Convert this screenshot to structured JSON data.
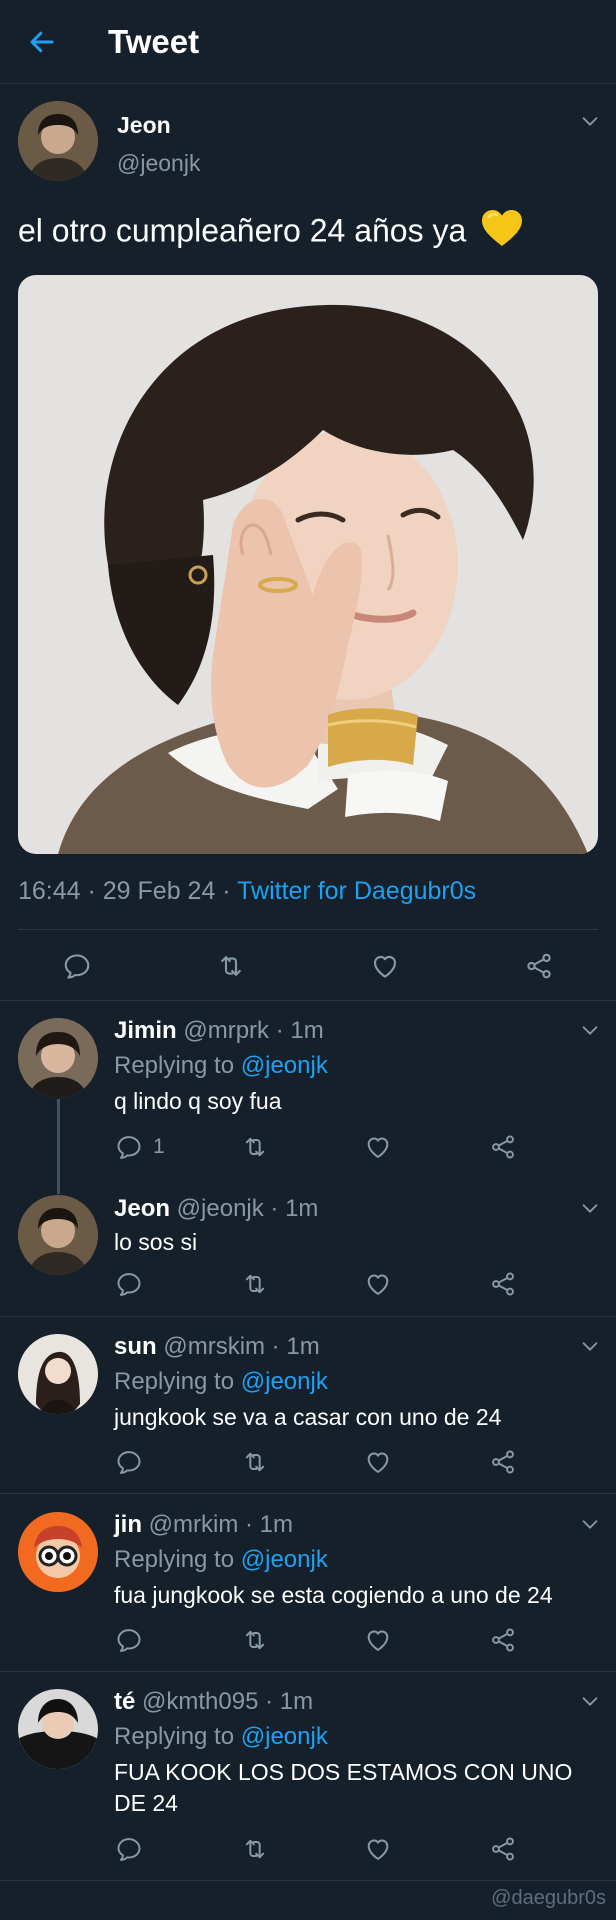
{
  "header": {
    "title": "Tweet"
  },
  "main_tweet": {
    "name": "Jeon",
    "handle": "@jeonjk",
    "text": "el otro cumpleañero 24 años ya",
    "time": "16:44 · 29 Feb 24 · ",
    "source": "Twitter for Daegubr0s"
  },
  "replies": [
    {
      "name": "Jimin",
      "meta": " @mrprk · 1m",
      "replying_label": "Replying to ",
      "replying_to": "@jeonjk",
      "text": "q lindo q soy fua",
      "reply_count": "1"
    },
    {
      "name": "Jeon",
      "meta": " @jeonjk · 1m",
      "text": "lo sos si"
    },
    {
      "name": "sun",
      "meta": " @mrskim · 1m",
      "replying_label": "Replying to ",
      "replying_to": "@jeonjk",
      "text": "jungkook se va a casar con uno de 24"
    },
    {
      "name": "jin",
      "meta": " @mrkim · 1m",
      "replying_label": "Replying to ",
      "replying_to": "@jeonjk",
      "text": "fua jungkook se esta cogiendo a uno de 24"
    },
    {
      "name": "té",
      "meta": " @kmth095 · 1m",
      "replying_label": "Replying to ",
      "replying_to": "@jeonjk",
      "text": "FUA KOOK LOS DOS ESTAMOS CON UNO DE 24"
    }
  ],
  "watermark": "@daegubr0s",
  "colors": {
    "background": "#15202b",
    "accent": "#1da1f2",
    "secondary_text": "#8899a6",
    "divider": "#2b3640"
  },
  "icons": [
    "back-arrow-icon",
    "chevron-down-icon",
    "reply-icon",
    "retweet-icon",
    "like-icon",
    "share-icon",
    "yellow-heart-icon"
  ]
}
